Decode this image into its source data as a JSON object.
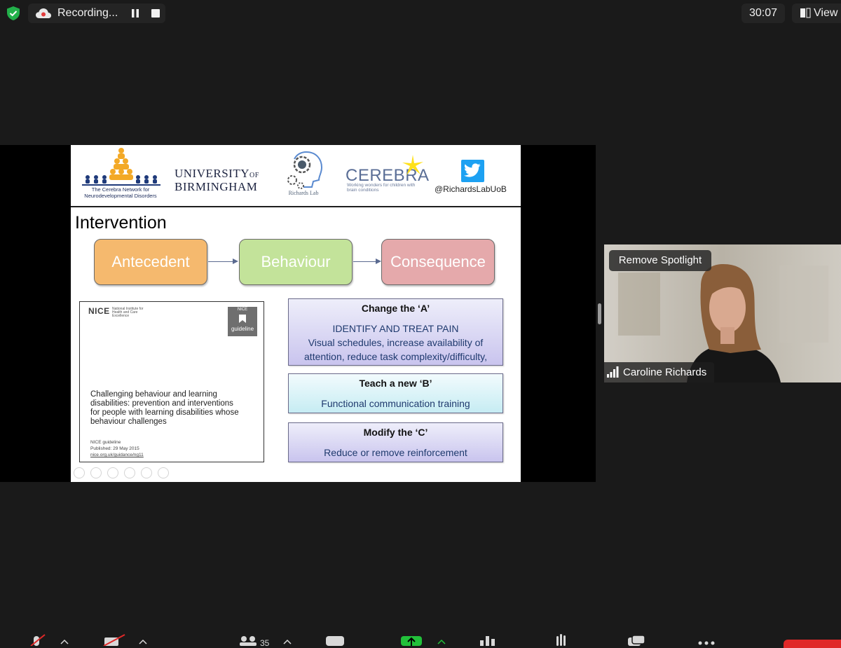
{
  "recording": {
    "label": "Recording..."
  },
  "timer": {
    "value": "30:07"
  },
  "view": {
    "label": "View"
  },
  "slide": {
    "logos": {
      "cerebra_network": "The Cerebra Network for Neurodevelopmental Disorders",
      "uob_line1": "UNIVERSITY",
      "uob_of": "OF",
      "uob_line2": "BIRMINGHAM",
      "richards_lab": "Richards Lab",
      "cerebra": "CEREBRA",
      "cerebra_tagline": "Working wonders for children with brain conditions",
      "twitter_handle": "@RichardsLabUoB"
    },
    "title": "Intervention",
    "abc": {
      "antecedent": "Antecedent",
      "behaviour": "Behaviour",
      "consequence": "Consequence"
    },
    "nice_doc": {
      "logo": "NICE",
      "institute": "National Institute for Health and Care Excellence",
      "badge_top": "NICE",
      "badge_label": "guideline",
      "title": "Challenging behaviour and learning disabilities: prevention and interventions for people with learning disabilities whose behaviour challenges",
      "meta_line1": "NICE guideline",
      "meta_line2": "Published: 29 May 2015",
      "meta_line3": "nice.org.uk/guidance/ng11"
    },
    "strategies": {
      "change_head": "Change the ‘A’",
      "change_line1": "IDENTIFY AND TREAT PAIN",
      "change_line2": "Visual schedules, increase availability of",
      "change_line3": "attention, reduce task complexity/difficulty,",
      "teach_head": "Teach a new ‘B’",
      "teach_body": "Functional communication training",
      "modify_head": "Modify the ‘C’",
      "modify_body": "Reduce or remove reinforcement"
    }
  },
  "video": {
    "remove_spotlight": "Remove Spotlight",
    "participant_name": "Caroline Richards"
  },
  "toolbar": {
    "participants_count": "35"
  },
  "colors": {
    "antecedent": "#f5b96e",
    "behaviour": "#c3e39a",
    "consequence": "#e5a9ab",
    "share_green": "#22c03a",
    "end_red": "#e02828",
    "twitter": "#1da1f2"
  }
}
